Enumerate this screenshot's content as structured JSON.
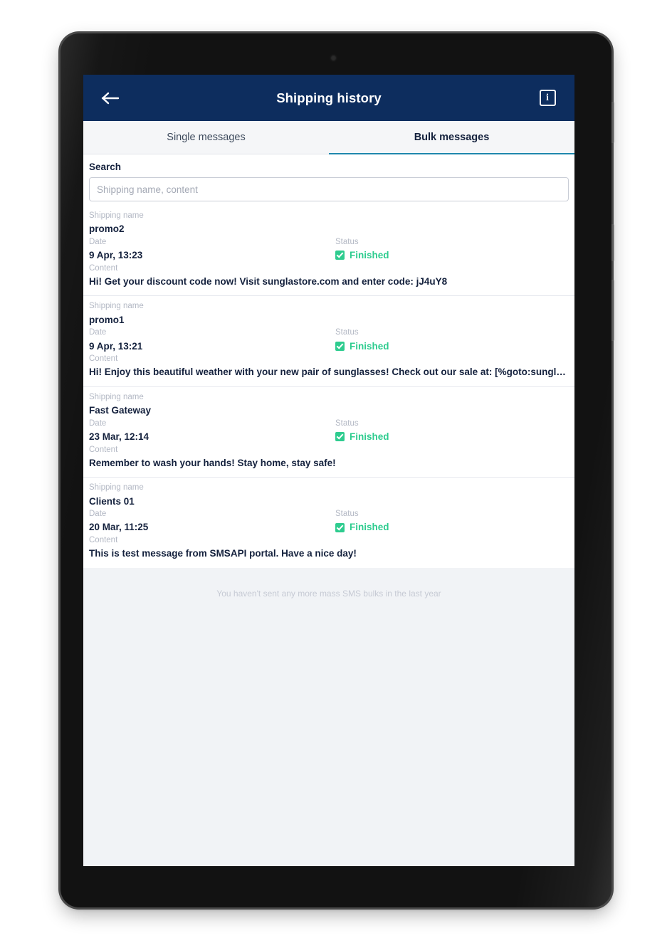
{
  "header": {
    "title": "Shipping history",
    "back_icon": "arrow-left-icon",
    "info_icon": "info-icon",
    "info_glyph": "i",
    "background_color": "#0d2d5e"
  },
  "tabs": [
    {
      "label": "Single messages",
      "active": false
    },
    {
      "label": "Bulk messages",
      "active": true
    }
  ],
  "tab_accent_color": "#1f87ad",
  "search": {
    "label": "Search",
    "placeholder": "Shipping name, content",
    "value": ""
  },
  "labels": {
    "shipping_name": "Shipping name",
    "date": "Date",
    "status": "Status",
    "content": "Content"
  },
  "status_color": "#2ecc8f",
  "rows": [
    {
      "shipping_name": "promo2",
      "date": "9 Apr, 13:23",
      "status": "Finished",
      "content": "Hi! Get your discount code now! Visit sunglastore.com and enter code: jJ4uY8"
    },
    {
      "shipping_name": "promo1",
      "date": "9 Apr, 13:21",
      "status": "Finished",
      "content": "Hi! Enjoy this beautiful weather with your new pair of sunglasses! Check out our sale at: [%goto:sunglastor..."
    },
    {
      "shipping_name": "Fast Gateway",
      "date": "23 Mar, 12:14",
      "status": "Finished",
      "content": "Remember to wash your hands! Stay home, stay safe!"
    },
    {
      "shipping_name": "Clients 01",
      "date": "20 Mar, 11:25",
      "status": "Finished",
      "content": "This is test message from SMSAPI portal. Have a nice day!"
    }
  ],
  "empty_note": "You haven't sent any more mass SMS bulks in the last year"
}
